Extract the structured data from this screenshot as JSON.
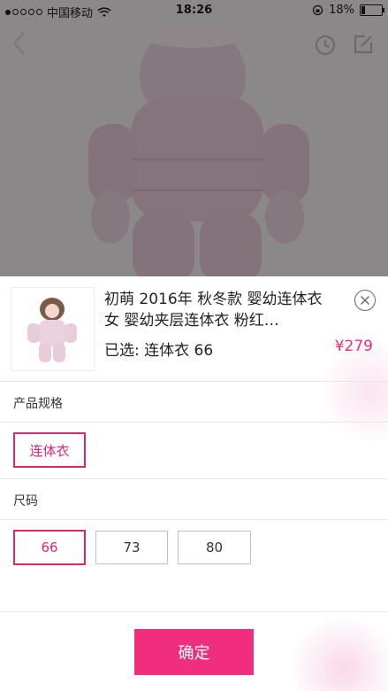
{
  "status_bar": {
    "carrier": "中国移动",
    "time": "18:26",
    "battery": "18%",
    "battery_level": 0.18,
    "signal_icon": "signal-dots-icon",
    "wifi_icon": "wifi-icon",
    "lock_icon": "orientation-lock-icon"
  },
  "nav": {
    "back_icon": "back-chevron-icon",
    "history_icon": "clock-icon",
    "share_icon": "edit-share-icon"
  },
  "product": {
    "title": "初萌 2016年 秋冬款 婴幼连体衣 女 婴幼夹层连体衣 粉红…",
    "selected_prefix": "已选:",
    "selected_value": "连体衣 66",
    "price": "¥279",
    "accent_color": "#ee2c79"
  },
  "spec": {
    "label": "产品规格",
    "options": [
      {
        "label": "连体衣",
        "selected": true
      }
    ]
  },
  "size": {
    "label": "尺码",
    "options": [
      {
        "label": "66",
        "selected": true
      },
      {
        "label": "73",
        "selected": false
      },
      {
        "label": "80",
        "selected": false
      }
    ]
  },
  "confirm_label": "确定"
}
